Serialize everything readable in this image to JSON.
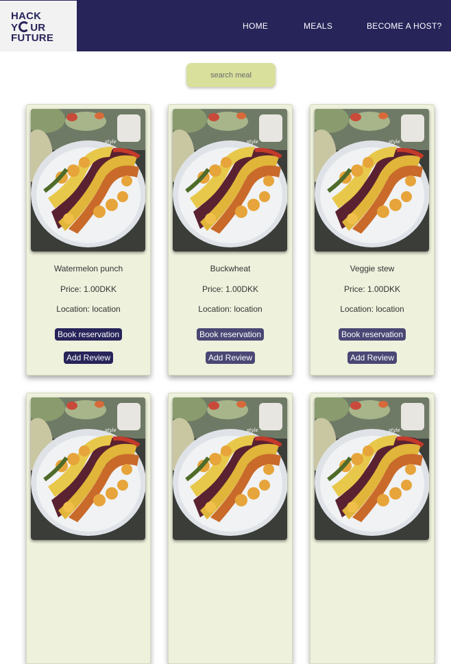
{
  "header": {
    "logo": {
      "line1": "HACK",
      "line2a": "Y",
      "line2b": "UR",
      "line3": "FUTURE"
    },
    "nav": [
      {
        "label": "HOME"
      },
      {
        "label": "MEALS"
      },
      {
        "label": "BECOME A HOST?"
      }
    ]
  },
  "search": {
    "placeholder": "search meal"
  },
  "meals": [
    {
      "title": "Watermelon punch",
      "price": "Price: 1.00DKK",
      "location": "Location: location",
      "book_label": "Book reservation",
      "review_label": "Add Review"
    },
    {
      "title": "Buckwheat",
      "price": "Price: 1.00DKK",
      "location": "Location: location",
      "book_label": "Book reservation",
      "review_label": "Add Review"
    },
    {
      "title": "Veggie stew",
      "price": "Price: 1.00DKK",
      "location": "Location: location",
      "book_label": "Book reservation",
      "review_label": "Add Review"
    },
    {
      "title": "",
      "price": "",
      "location": "",
      "book_label": "",
      "review_label": ""
    },
    {
      "title": "",
      "price": "",
      "location": "",
      "book_label": "",
      "review_label": ""
    },
    {
      "title": "",
      "price": "",
      "location": "",
      "book_label": "",
      "review_label": ""
    }
  ],
  "colors": {
    "header_bg": "#27245a",
    "card_bg": "#eef1dc",
    "search_bg": "#d8e09c",
    "button_bg": "#27245a"
  }
}
